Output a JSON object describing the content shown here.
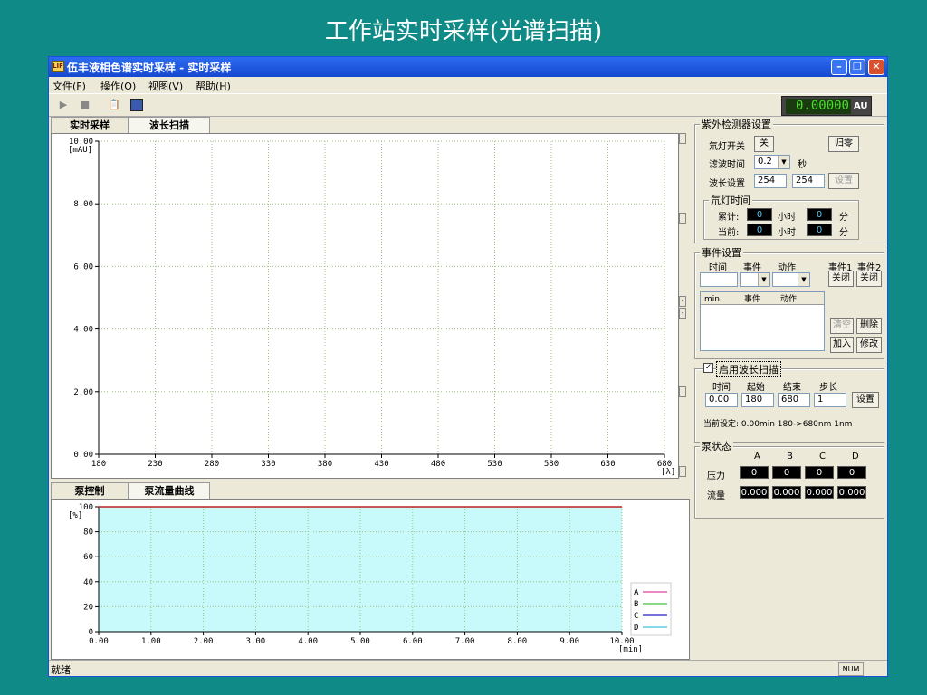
{
  "slide_title": "工作站实时采样(光谱扫描)",
  "window": {
    "app_icon": "LIF",
    "title": "伍丰液相色谱实时采样 - 实时采样",
    "controls": [
      "minimize-icon",
      "restore-icon",
      "close-icon"
    ]
  },
  "menu": [
    "文件(F)",
    "操作(O)",
    "视图(V)",
    "帮助(H)"
  ],
  "toolbar": {
    "icons": [
      "play-icon",
      "stop-icon",
      "clipboard-icon",
      "monitor-icon"
    ],
    "au_display": "0.00000",
    "au_unit": "AU"
  },
  "top_tabs": [
    "实时采样",
    "波长扫描"
  ],
  "bottom_tabs": [
    "泵控制",
    "泵流量曲线"
  ],
  "chart_data": [
    {
      "type": "line",
      "ylabel": "[mAU]",
      "xlabel": "[λ]",
      "x_ticks": [
        "180",
        "230",
        "280",
        "330",
        "380",
        "430",
        "480",
        "530",
        "580",
        "630",
        "680"
      ],
      "y_ticks": [
        "10.00",
        "8.00",
        "6.00",
        "4.00",
        "2.00",
        "0.00"
      ],
      "xlim": [
        180,
        680
      ],
      "ylim": [
        0,
        10
      ],
      "grid": true,
      "series": []
    },
    {
      "type": "line",
      "ylabel": "[%]",
      "xlabel": "[min]",
      "x_ticks": [
        "0.00",
        "1.00",
        "2.00",
        "3.00",
        "4.00",
        "5.00",
        "6.00",
        "7.00",
        "8.00",
        "9.00",
        "10.00"
      ],
      "y_ticks": [
        "100",
        "80",
        "60",
        "40",
        "20",
        "0"
      ],
      "xlim": [
        0,
        10
      ],
      "ylim": [
        0,
        100
      ],
      "grid": true,
      "series": [
        {
          "name": "A",
          "color": "#e040a0",
          "values": [
            [
              0,
              100
            ],
            [
              10,
              100
            ]
          ]
        },
        {
          "name": "B",
          "color": "#40c040",
          "values": []
        },
        {
          "name": "C",
          "color": "#2020c0",
          "values": []
        },
        {
          "name": "D",
          "color": "#40c0e0",
          "values": []
        }
      ]
    }
  ],
  "uv_detector": {
    "title": "紫外检测器设置",
    "lamp_switch_label": "氘灯开关",
    "lamp_switch_value": "关",
    "zero_button": "归零",
    "filter_label": "滤波时间",
    "filter_value": "0.2",
    "filter_unit": "秒",
    "wavelength_label": "波长设置",
    "wavelength_1": "254",
    "wavelength_2": "254",
    "set_button": "设置",
    "lamp_time": {
      "title": "氘灯时间",
      "total_label": "累计:",
      "current_label": "当前:",
      "total_hours": "0",
      "total_minutes": "0",
      "current_hours": "0",
      "current_minutes": "0",
      "hours_unit": "小时",
      "minutes_unit": "分"
    }
  },
  "events": {
    "title": "事件设置",
    "headers": [
      "时间",
      "事件",
      "动作"
    ],
    "event1_label": "事件1",
    "event2_label": "事件2",
    "event1_button": "关闭",
    "event2_button": "关闭",
    "list_headers": [
      "min",
      "事件",
      "动作"
    ],
    "clear_button": "清空",
    "delete_button": "删除",
    "add_button": "加入",
    "modify_button": "修改"
  },
  "wavelength_scan": {
    "checkbox_label": "启用波长扫描",
    "checked": true,
    "headers": [
      "时间",
      "起始",
      "结束",
      "步长"
    ],
    "time": "0.00",
    "start": "180",
    "end": "680",
    "step": "1",
    "set_button": "设置",
    "current_setting": "当前设定: 0.00min 180->680nm 1nm"
  },
  "pump_status": {
    "title": "泵状态",
    "channels": [
      "A",
      "B",
      "C",
      "D"
    ],
    "pressure_label": "压力",
    "flow_label": "流量",
    "pressure": [
      "0",
      "0",
      "0",
      "0"
    ],
    "flow": [
      "0.000",
      "0.000",
      "0.000",
      "0.000"
    ]
  },
  "status": {
    "text": "就绪",
    "num": "NUM"
  }
}
